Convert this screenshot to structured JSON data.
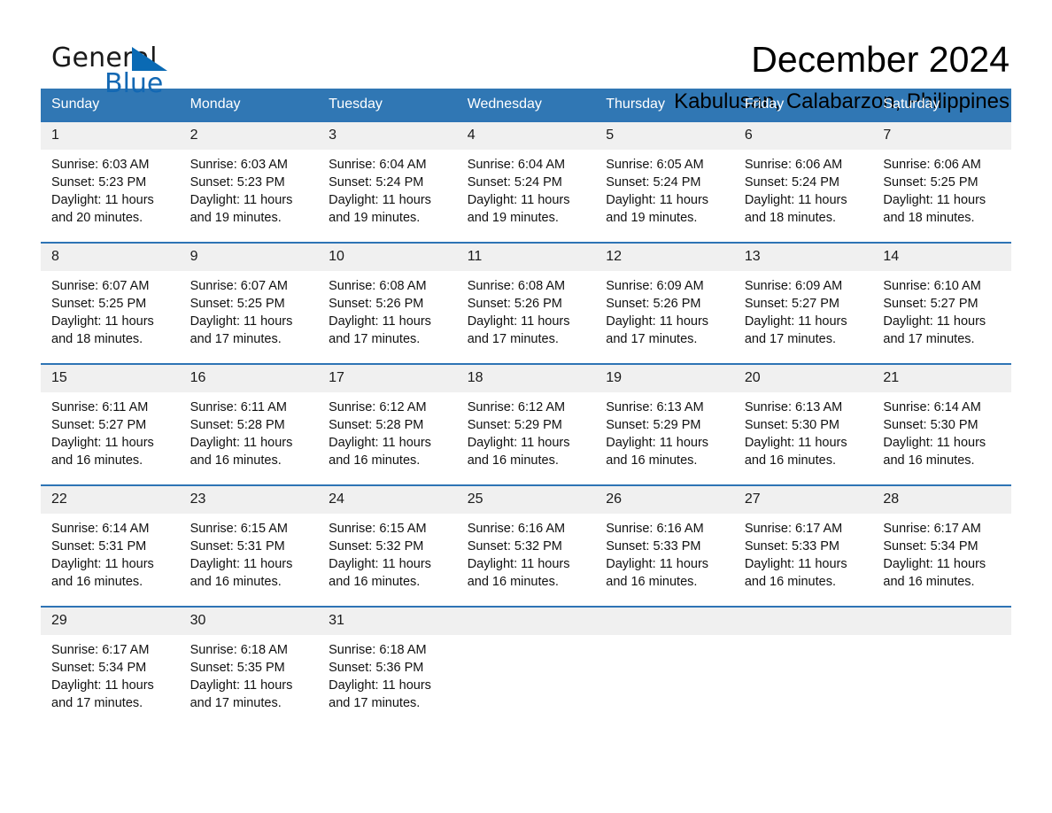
{
  "brand": {
    "word_one": "General",
    "word_two": "Blue",
    "triangle_icon": "triangle-icon",
    "blue": "#1368b3"
  },
  "header": {
    "title": "December 2024",
    "subtitle": "Kabulusan, Calabarzon, Philippines"
  },
  "colors": {
    "header_blue": "#3077b4",
    "row_rule_blue": "#2e74b5",
    "daynum_band": "#f0f0f0"
  },
  "calendar": {
    "weekday_headers": [
      "Sunday",
      "Monday",
      "Tuesday",
      "Wednesday",
      "Thursday",
      "Friday",
      "Saturday"
    ],
    "weeks": [
      [
        {
          "day": "1",
          "sunrise": "Sunrise: 6:03 AM",
          "sunset": "Sunset: 5:23 PM",
          "daylight_line1": "Daylight: 11 hours",
          "daylight_line2": "and 20 minutes."
        },
        {
          "day": "2",
          "sunrise": "Sunrise: 6:03 AM",
          "sunset": "Sunset: 5:23 PM",
          "daylight_line1": "Daylight: 11 hours",
          "daylight_line2": "and 19 minutes."
        },
        {
          "day": "3",
          "sunrise": "Sunrise: 6:04 AM",
          "sunset": "Sunset: 5:24 PM",
          "daylight_line1": "Daylight: 11 hours",
          "daylight_line2": "and 19 minutes."
        },
        {
          "day": "4",
          "sunrise": "Sunrise: 6:04 AM",
          "sunset": "Sunset: 5:24 PM",
          "daylight_line1": "Daylight: 11 hours",
          "daylight_line2": "and 19 minutes."
        },
        {
          "day": "5",
          "sunrise": "Sunrise: 6:05 AM",
          "sunset": "Sunset: 5:24 PM",
          "daylight_line1": "Daylight: 11 hours",
          "daylight_line2": "and 19 minutes."
        },
        {
          "day": "6",
          "sunrise": "Sunrise: 6:06 AM",
          "sunset": "Sunset: 5:24 PM",
          "daylight_line1": "Daylight: 11 hours",
          "daylight_line2": "and 18 minutes."
        },
        {
          "day": "7",
          "sunrise": "Sunrise: 6:06 AM",
          "sunset": "Sunset: 5:25 PM",
          "daylight_line1": "Daylight: 11 hours",
          "daylight_line2": "and 18 minutes."
        }
      ],
      [
        {
          "day": "8",
          "sunrise": "Sunrise: 6:07 AM",
          "sunset": "Sunset: 5:25 PM",
          "daylight_line1": "Daylight: 11 hours",
          "daylight_line2": "and 18 minutes."
        },
        {
          "day": "9",
          "sunrise": "Sunrise: 6:07 AM",
          "sunset": "Sunset: 5:25 PM",
          "daylight_line1": "Daylight: 11 hours",
          "daylight_line2": "and 17 minutes."
        },
        {
          "day": "10",
          "sunrise": "Sunrise: 6:08 AM",
          "sunset": "Sunset: 5:26 PM",
          "daylight_line1": "Daylight: 11 hours",
          "daylight_line2": "and 17 minutes."
        },
        {
          "day": "11",
          "sunrise": "Sunrise: 6:08 AM",
          "sunset": "Sunset: 5:26 PM",
          "daylight_line1": "Daylight: 11 hours",
          "daylight_line2": "and 17 minutes."
        },
        {
          "day": "12",
          "sunrise": "Sunrise: 6:09 AM",
          "sunset": "Sunset: 5:26 PM",
          "daylight_line1": "Daylight: 11 hours",
          "daylight_line2": "and 17 minutes."
        },
        {
          "day": "13",
          "sunrise": "Sunrise: 6:09 AM",
          "sunset": "Sunset: 5:27 PM",
          "daylight_line1": "Daylight: 11 hours",
          "daylight_line2": "and 17 minutes."
        },
        {
          "day": "14",
          "sunrise": "Sunrise: 6:10 AM",
          "sunset": "Sunset: 5:27 PM",
          "daylight_line1": "Daylight: 11 hours",
          "daylight_line2": "and 17 minutes."
        }
      ],
      [
        {
          "day": "15",
          "sunrise": "Sunrise: 6:11 AM",
          "sunset": "Sunset: 5:27 PM",
          "daylight_line1": "Daylight: 11 hours",
          "daylight_line2": "and 16 minutes."
        },
        {
          "day": "16",
          "sunrise": "Sunrise: 6:11 AM",
          "sunset": "Sunset: 5:28 PM",
          "daylight_line1": "Daylight: 11 hours",
          "daylight_line2": "and 16 minutes."
        },
        {
          "day": "17",
          "sunrise": "Sunrise: 6:12 AM",
          "sunset": "Sunset: 5:28 PM",
          "daylight_line1": "Daylight: 11 hours",
          "daylight_line2": "and 16 minutes."
        },
        {
          "day": "18",
          "sunrise": "Sunrise: 6:12 AM",
          "sunset": "Sunset: 5:29 PM",
          "daylight_line1": "Daylight: 11 hours",
          "daylight_line2": "and 16 minutes."
        },
        {
          "day": "19",
          "sunrise": "Sunrise: 6:13 AM",
          "sunset": "Sunset: 5:29 PM",
          "daylight_line1": "Daylight: 11 hours",
          "daylight_line2": "and 16 minutes."
        },
        {
          "day": "20",
          "sunrise": "Sunrise: 6:13 AM",
          "sunset": "Sunset: 5:30 PM",
          "daylight_line1": "Daylight: 11 hours",
          "daylight_line2": "and 16 minutes."
        },
        {
          "day": "21",
          "sunrise": "Sunrise: 6:14 AM",
          "sunset": "Sunset: 5:30 PM",
          "daylight_line1": "Daylight: 11 hours",
          "daylight_line2": "and 16 minutes."
        }
      ],
      [
        {
          "day": "22",
          "sunrise": "Sunrise: 6:14 AM",
          "sunset": "Sunset: 5:31 PM",
          "daylight_line1": "Daylight: 11 hours",
          "daylight_line2": "and 16 minutes."
        },
        {
          "day": "23",
          "sunrise": "Sunrise: 6:15 AM",
          "sunset": "Sunset: 5:31 PM",
          "daylight_line1": "Daylight: 11 hours",
          "daylight_line2": "and 16 minutes."
        },
        {
          "day": "24",
          "sunrise": "Sunrise: 6:15 AM",
          "sunset": "Sunset: 5:32 PM",
          "daylight_line1": "Daylight: 11 hours",
          "daylight_line2": "and 16 minutes."
        },
        {
          "day": "25",
          "sunrise": "Sunrise: 6:16 AM",
          "sunset": "Sunset: 5:32 PM",
          "daylight_line1": "Daylight: 11 hours",
          "daylight_line2": "and 16 minutes."
        },
        {
          "day": "26",
          "sunrise": "Sunrise: 6:16 AM",
          "sunset": "Sunset: 5:33 PM",
          "daylight_line1": "Daylight: 11 hours",
          "daylight_line2": "and 16 minutes."
        },
        {
          "day": "27",
          "sunrise": "Sunrise: 6:17 AM",
          "sunset": "Sunset: 5:33 PM",
          "daylight_line1": "Daylight: 11 hours",
          "daylight_line2": "and 16 minutes."
        },
        {
          "day": "28",
          "sunrise": "Sunrise: 6:17 AM",
          "sunset": "Sunset: 5:34 PM",
          "daylight_line1": "Daylight: 11 hours",
          "daylight_line2": "and 16 minutes."
        }
      ],
      [
        {
          "day": "29",
          "sunrise": "Sunrise: 6:17 AM",
          "sunset": "Sunset: 5:34 PM",
          "daylight_line1": "Daylight: 11 hours",
          "daylight_line2": "and 17 minutes."
        },
        {
          "day": "30",
          "sunrise": "Sunrise: 6:18 AM",
          "sunset": "Sunset: 5:35 PM",
          "daylight_line1": "Daylight: 11 hours",
          "daylight_line2": "and 17 minutes."
        },
        {
          "day": "31",
          "sunrise": "Sunrise: 6:18 AM",
          "sunset": "Sunset: 5:36 PM",
          "daylight_line1": "Daylight: 11 hours",
          "daylight_line2": "and 17 minutes."
        },
        {
          "day": "",
          "sunrise": "",
          "sunset": "",
          "daylight_line1": "",
          "daylight_line2": ""
        },
        {
          "day": "",
          "sunrise": "",
          "sunset": "",
          "daylight_line1": "",
          "daylight_line2": ""
        },
        {
          "day": "",
          "sunrise": "",
          "sunset": "",
          "daylight_line1": "",
          "daylight_line2": ""
        },
        {
          "day": "",
          "sunrise": "",
          "sunset": "",
          "daylight_line1": "",
          "daylight_line2": ""
        }
      ]
    ]
  }
}
